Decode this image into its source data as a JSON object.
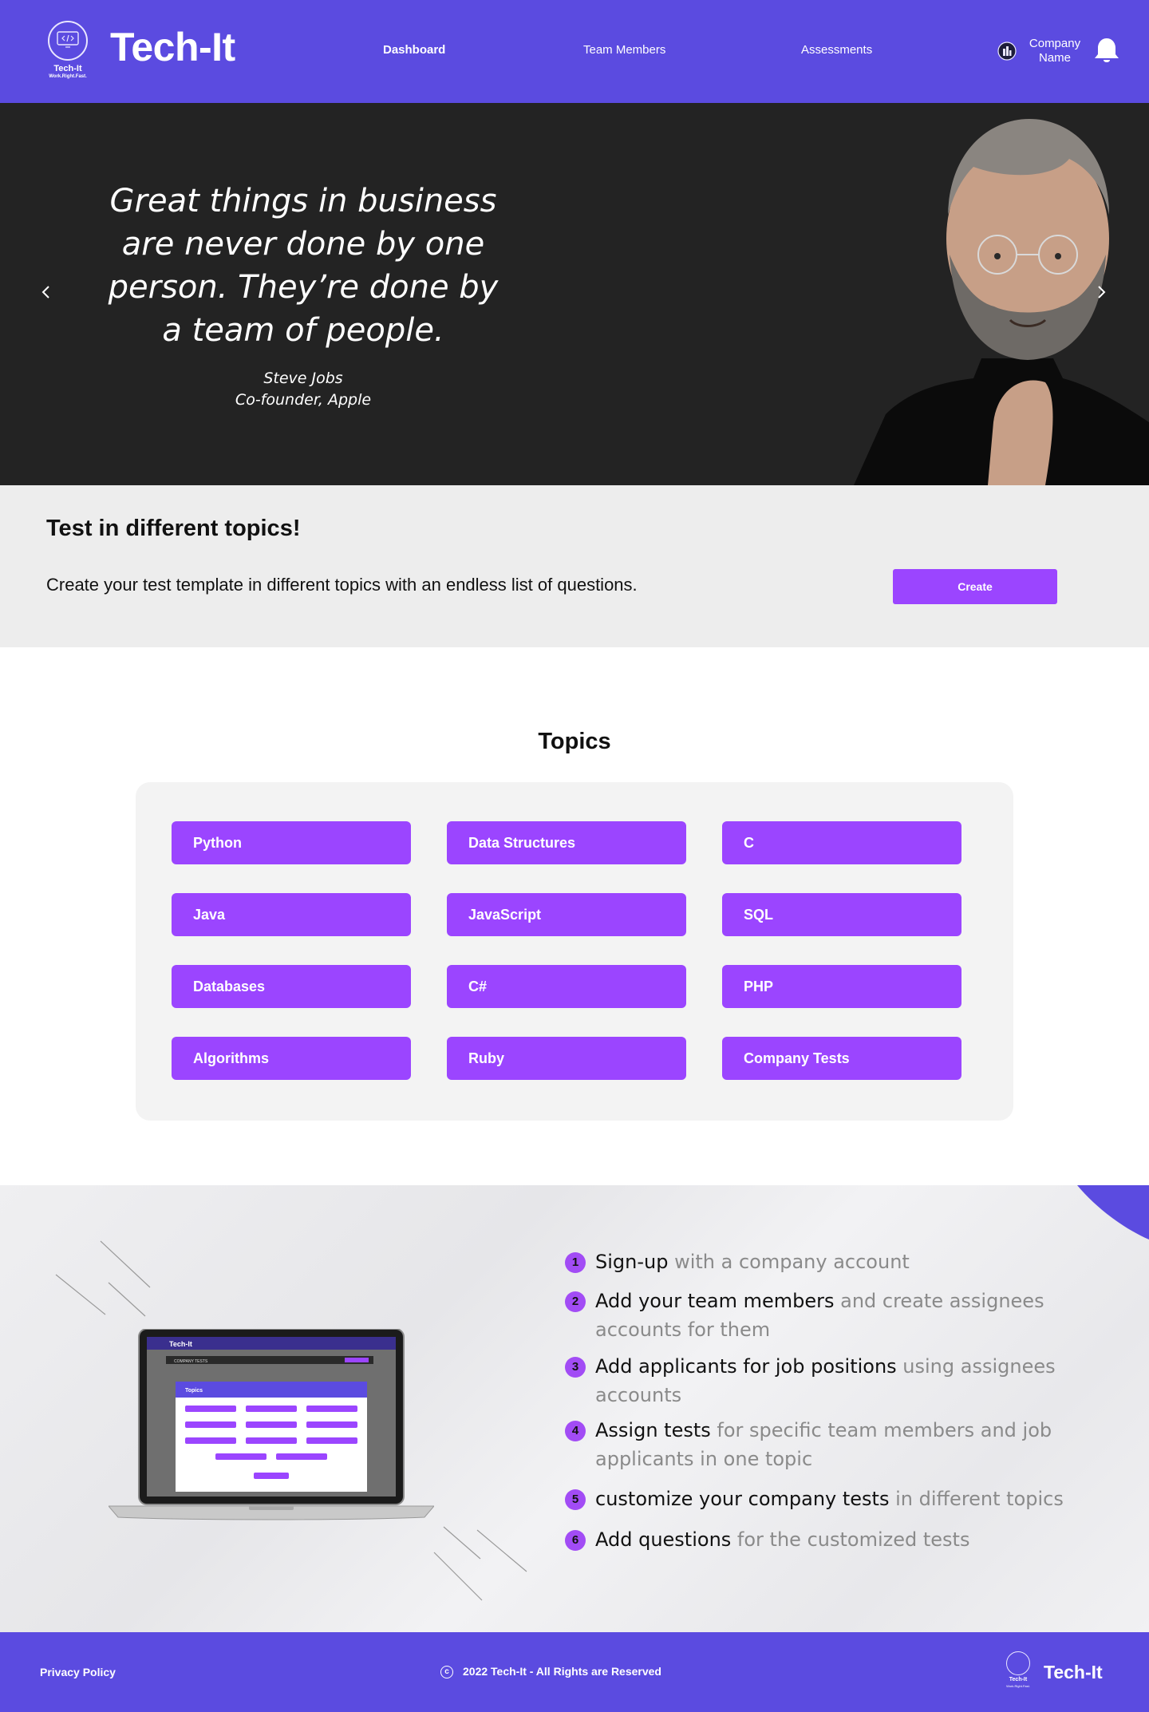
{
  "header": {
    "logo_name": "Tech-It",
    "logo_tagline": "Work.Right.Fast.",
    "brand": "Tech-It",
    "nav": {
      "dashboard": "Dashboard",
      "team_members": "Team Members",
      "assessments": "Assessments"
    },
    "company_line1": "Company",
    "company_line2": "Name",
    "icons": {
      "company": "company-building-icon",
      "notifications": "bell-icon"
    }
  },
  "hero": {
    "quote": "Great things in business are never done by one person. They’re done by a team of people.",
    "author_name": "Steve Jobs",
    "author_title": "Co-founder, Apple",
    "icons": {
      "prev": "chevron-left-icon",
      "next": "chevron-right-icon"
    }
  },
  "banner": {
    "title": "Test in different topics!",
    "text": "Create your test template in different topics with an endless list of questions.",
    "create_label": "Create"
  },
  "topics": {
    "title": "Topics",
    "items": [
      "Python",
      "Data Structures",
      "C",
      "Java",
      "JavaScript",
      "SQL",
      "Databases",
      "C#",
      "PHP",
      "Algorithms",
      "Ruby",
      "Company Tests"
    ]
  },
  "how_it_works": {
    "steps": [
      {
        "num": "1",
        "strong": "Sign-up",
        "muted": " with a company account"
      },
      {
        "num": "2",
        "strong": "Add your team members",
        "muted": " and create assignees accounts for them"
      },
      {
        "num": "3",
        "strong": "Add applicants for job positions",
        "muted": " using assignees accounts"
      },
      {
        "num": "4",
        "strong": "Assign tests",
        "muted": " for specific team members and job applicants in one topic"
      },
      {
        "num": "5",
        "strong": "customize your company tests",
        "muted": " in different topics"
      },
      {
        "num": "6",
        "strong": "Add questions",
        "muted": " for the customized tests"
      }
    ],
    "laptop_screen": {
      "brand": "Tech-It",
      "section": "COMPANY TESTS",
      "modal_title": "Topics"
    }
  },
  "footer": {
    "privacy": "Privacy Policy",
    "copyright": "2022  Tech-It - All Rights are Reserved",
    "logo_name": "Tech-It",
    "logo_tagline": "Work.Right.Fast.",
    "brand": "Tech-It",
    "icons": {
      "copyright": "copyright-icon"
    }
  },
  "colors": {
    "header_bg": "#5b4be0",
    "accent_purple": "#9b45ff",
    "hero_bg": "#232323",
    "banner_bg": "#ededed",
    "panel_bg": "#f3f3f3"
  }
}
